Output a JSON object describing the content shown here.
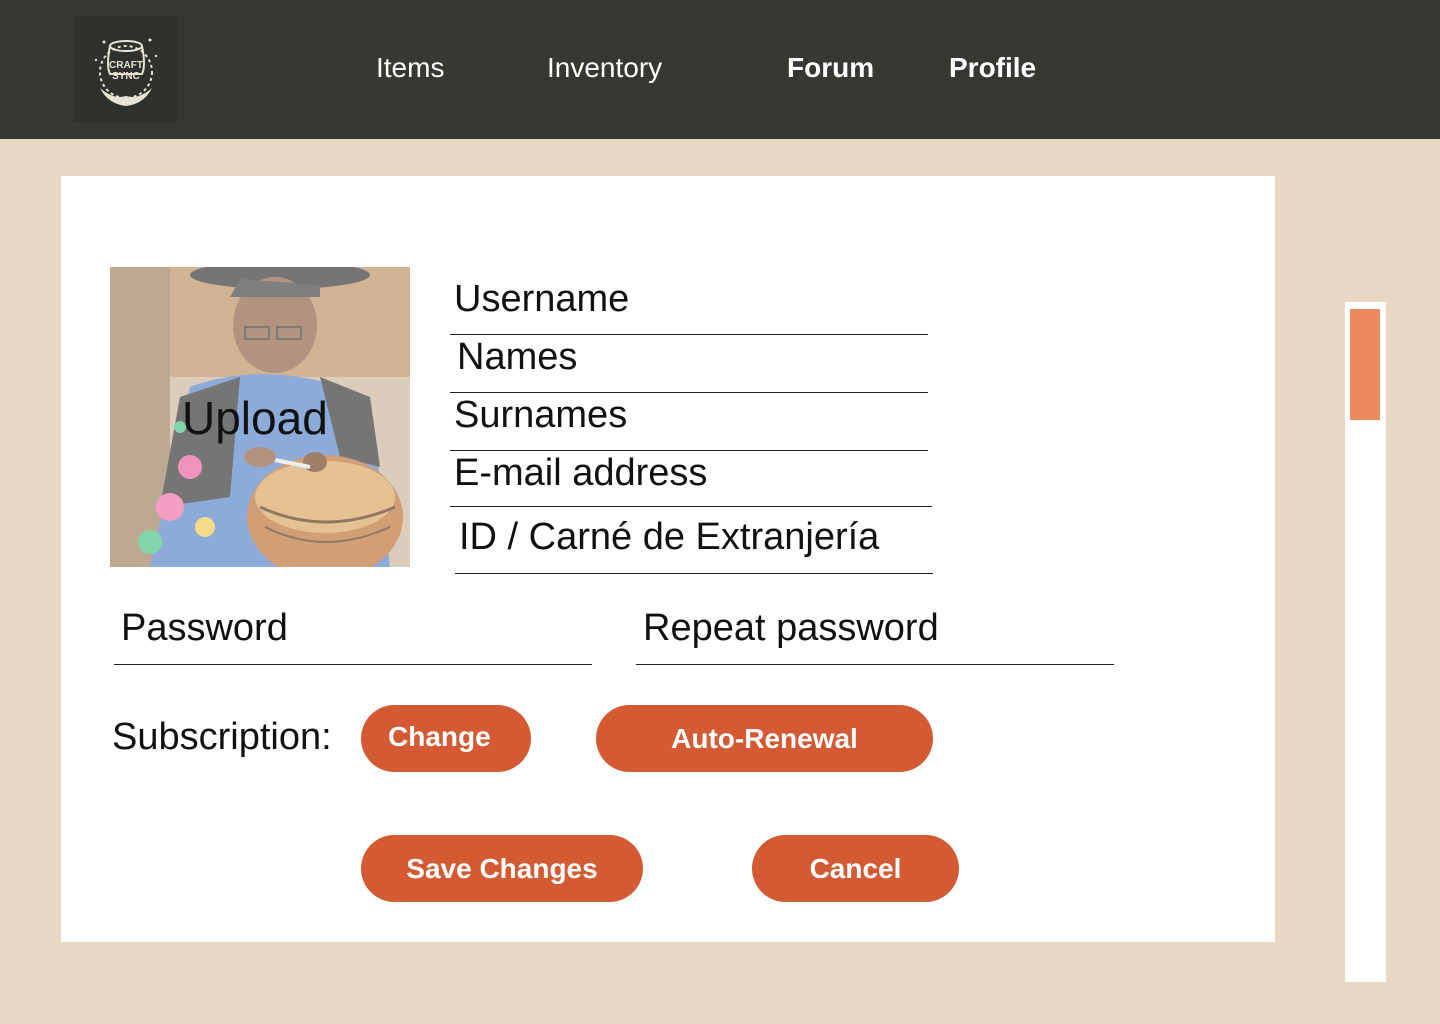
{
  "header": {
    "logo_text": [
      "CRAFT",
      "SYNC"
    ],
    "nav": [
      {
        "label": "Items"
      },
      {
        "label": "Inventory"
      },
      {
        "label": "Forum"
      },
      {
        "label": "Profile"
      }
    ]
  },
  "profile_form": {
    "photo_upload_label": "Upload",
    "fields": {
      "username": "Username",
      "names": "Names",
      "surnames": "Surnames",
      "email": "E-mail address",
      "id_document": "ID / Carné de Extranjería",
      "password": "Password",
      "repeat_password": "Repeat password"
    },
    "subscription": {
      "label": "Subscription:",
      "change_label": "Change",
      "auto_renewal_label": "Auto-Renewal"
    },
    "actions": {
      "save_label": "Save Changes",
      "cancel_label": "Cancel"
    }
  },
  "colors": {
    "header_bg": "#363833",
    "page_bg": "#e8d8c4",
    "accent": "#d35a32",
    "scroll_thumb": "#ec8a5f"
  },
  "icons": {
    "logo": "craft-sync-logo",
    "avatar": "artisan-photo"
  }
}
